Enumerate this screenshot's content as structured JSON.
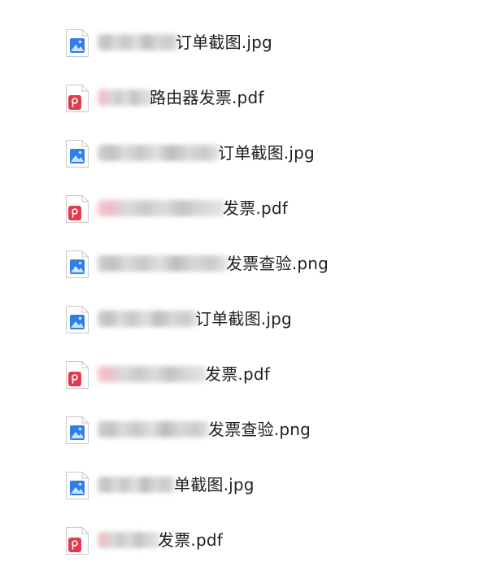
{
  "files": [
    {
      "name": "订单截图.jpg",
      "type": "image"
    },
    {
      "name": "路由器发票.pdf",
      "type": "pdf"
    },
    {
      "name": "订单截图.jpg",
      "type": "image"
    },
    {
      "name": "发票.pdf",
      "type": "pdf"
    },
    {
      "name": "发票查验.png",
      "type": "image"
    },
    {
      "name": "订单截图.jpg",
      "type": "image"
    },
    {
      "name": "发票.pdf",
      "type": "pdf"
    },
    {
      "name": "发票查验.png",
      "type": "image"
    },
    {
      "name": "单截图.jpg",
      "type": "image"
    },
    {
      "name": "发票.pdf",
      "type": "pdf"
    }
  ],
  "colors": {
    "image_icon_blue": "#2f7fe6",
    "pdf_icon_red": "#e23b4e",
    "text": "#1f1f1f"
  }
}
